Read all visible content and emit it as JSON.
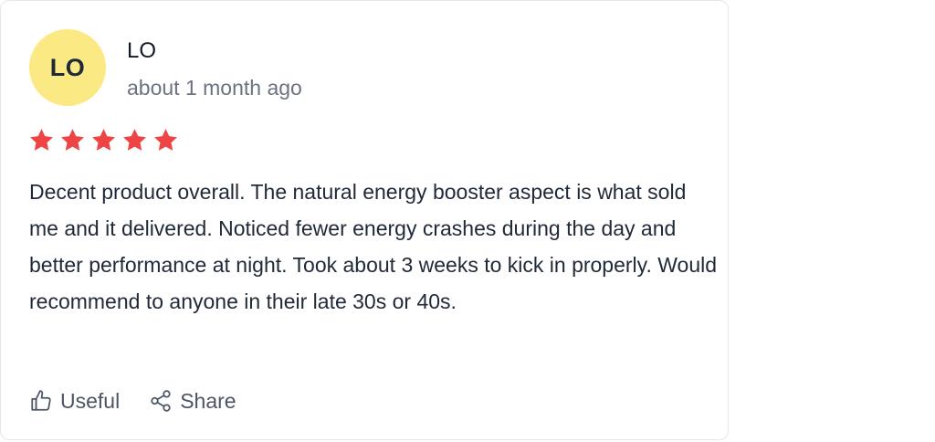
{
  "reviewer": {
    "initials": "LO",
    "name": "LO",
    "date": "about 1 month ago",
    "avatar_color": "#fbe983"
  },
  "rating": {
    "value": 5,
    "max": 5,
    "star_color": "#ef4444"
  },
  "review": {
    "text": "Decent product overall. The natural energy booster aspect is what sold me and it delivered. Noticed fewer energy crashes during the day and better performance at night. Took about 3 weeks to kick in properly. Would recommend to anyone in their late 30s or 40s."
  },
  "actions": {
    "useful_label": "Useful",
    "useful_icon": "thumbs-up-icon",
    "share_label": "Share",
    "share_icon": "share-icon"
  }
}
